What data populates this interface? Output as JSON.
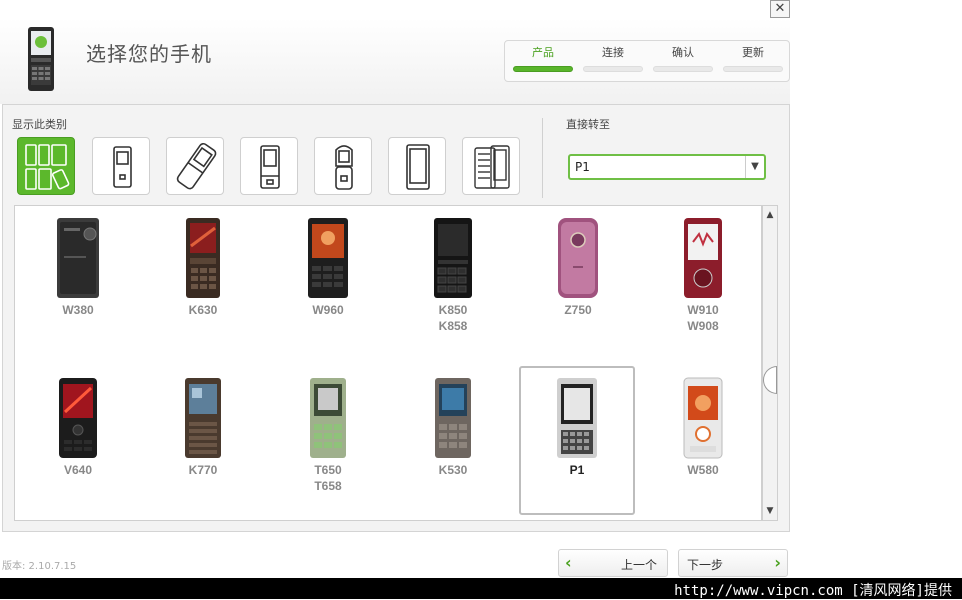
{
  "window": {
    "close_glyph": "✕"
  },
  "header": {
    "title": "选择您的手机",
    "icon": "phone-icon"
  },
  "steps": [
    {
      "label": "产品",
      "active": true
    },
    {
      "label": "连接",
      "active": false
    },
    {
      "label": "确认",
      "active": false
    },
    {
      "label": "更新",
      "active": false
    }
  ],
  "categories": {
    "label": "显示此类别",
    "items": [
      "all-phones-icon",
      "candybar-icon",
      "flip-open-icon",
      "slider-icon",
      "clamshell-icon",
      "touchscreen-icon",
      "qwerty-slider-icon"
    ]
  },
  "jump": {
    "label": "直接转至",
    "value": "P1"
  },
  "phones": [
    {
      "name": "W380",
      "name2": ""
    },
    {
      "name": "K630",
      "name2": ""
    },
    {
      "name": "W960",
      "name2": ""
    },
    {
      "name": "K850",
      "name2": "K858"
    },
    {
      "name": "Z750",
      "name2": ""
    },
    {
      "name": "W910",
      "name2": "W908"
    },
    {
      "name": "V640",
      "name2": ""
    },
    {
      "name": "K770",
      "name2": ""
    },
    {
      "name": "T650",
      "name2": "T658"
    },
    {
      "name": "K530",
      "name2": ""
    },
    {
      "name": "P1",
      "name2": "",
      "selected": true
    },
    {
      "name": "W580",
      "name2": ""
    }
  ],
  "footer": {
    "version": "版本: 2.10.7.15",
    "prev_label": "上一个",
    "next_label": "下一步"
  },
  "watermark": "http://www.vipcn.com [清风网络]提供",
  "colors": {
    "accent": "#5cb82c",
    "selected_border": "#bdbdbd"
  }
}
